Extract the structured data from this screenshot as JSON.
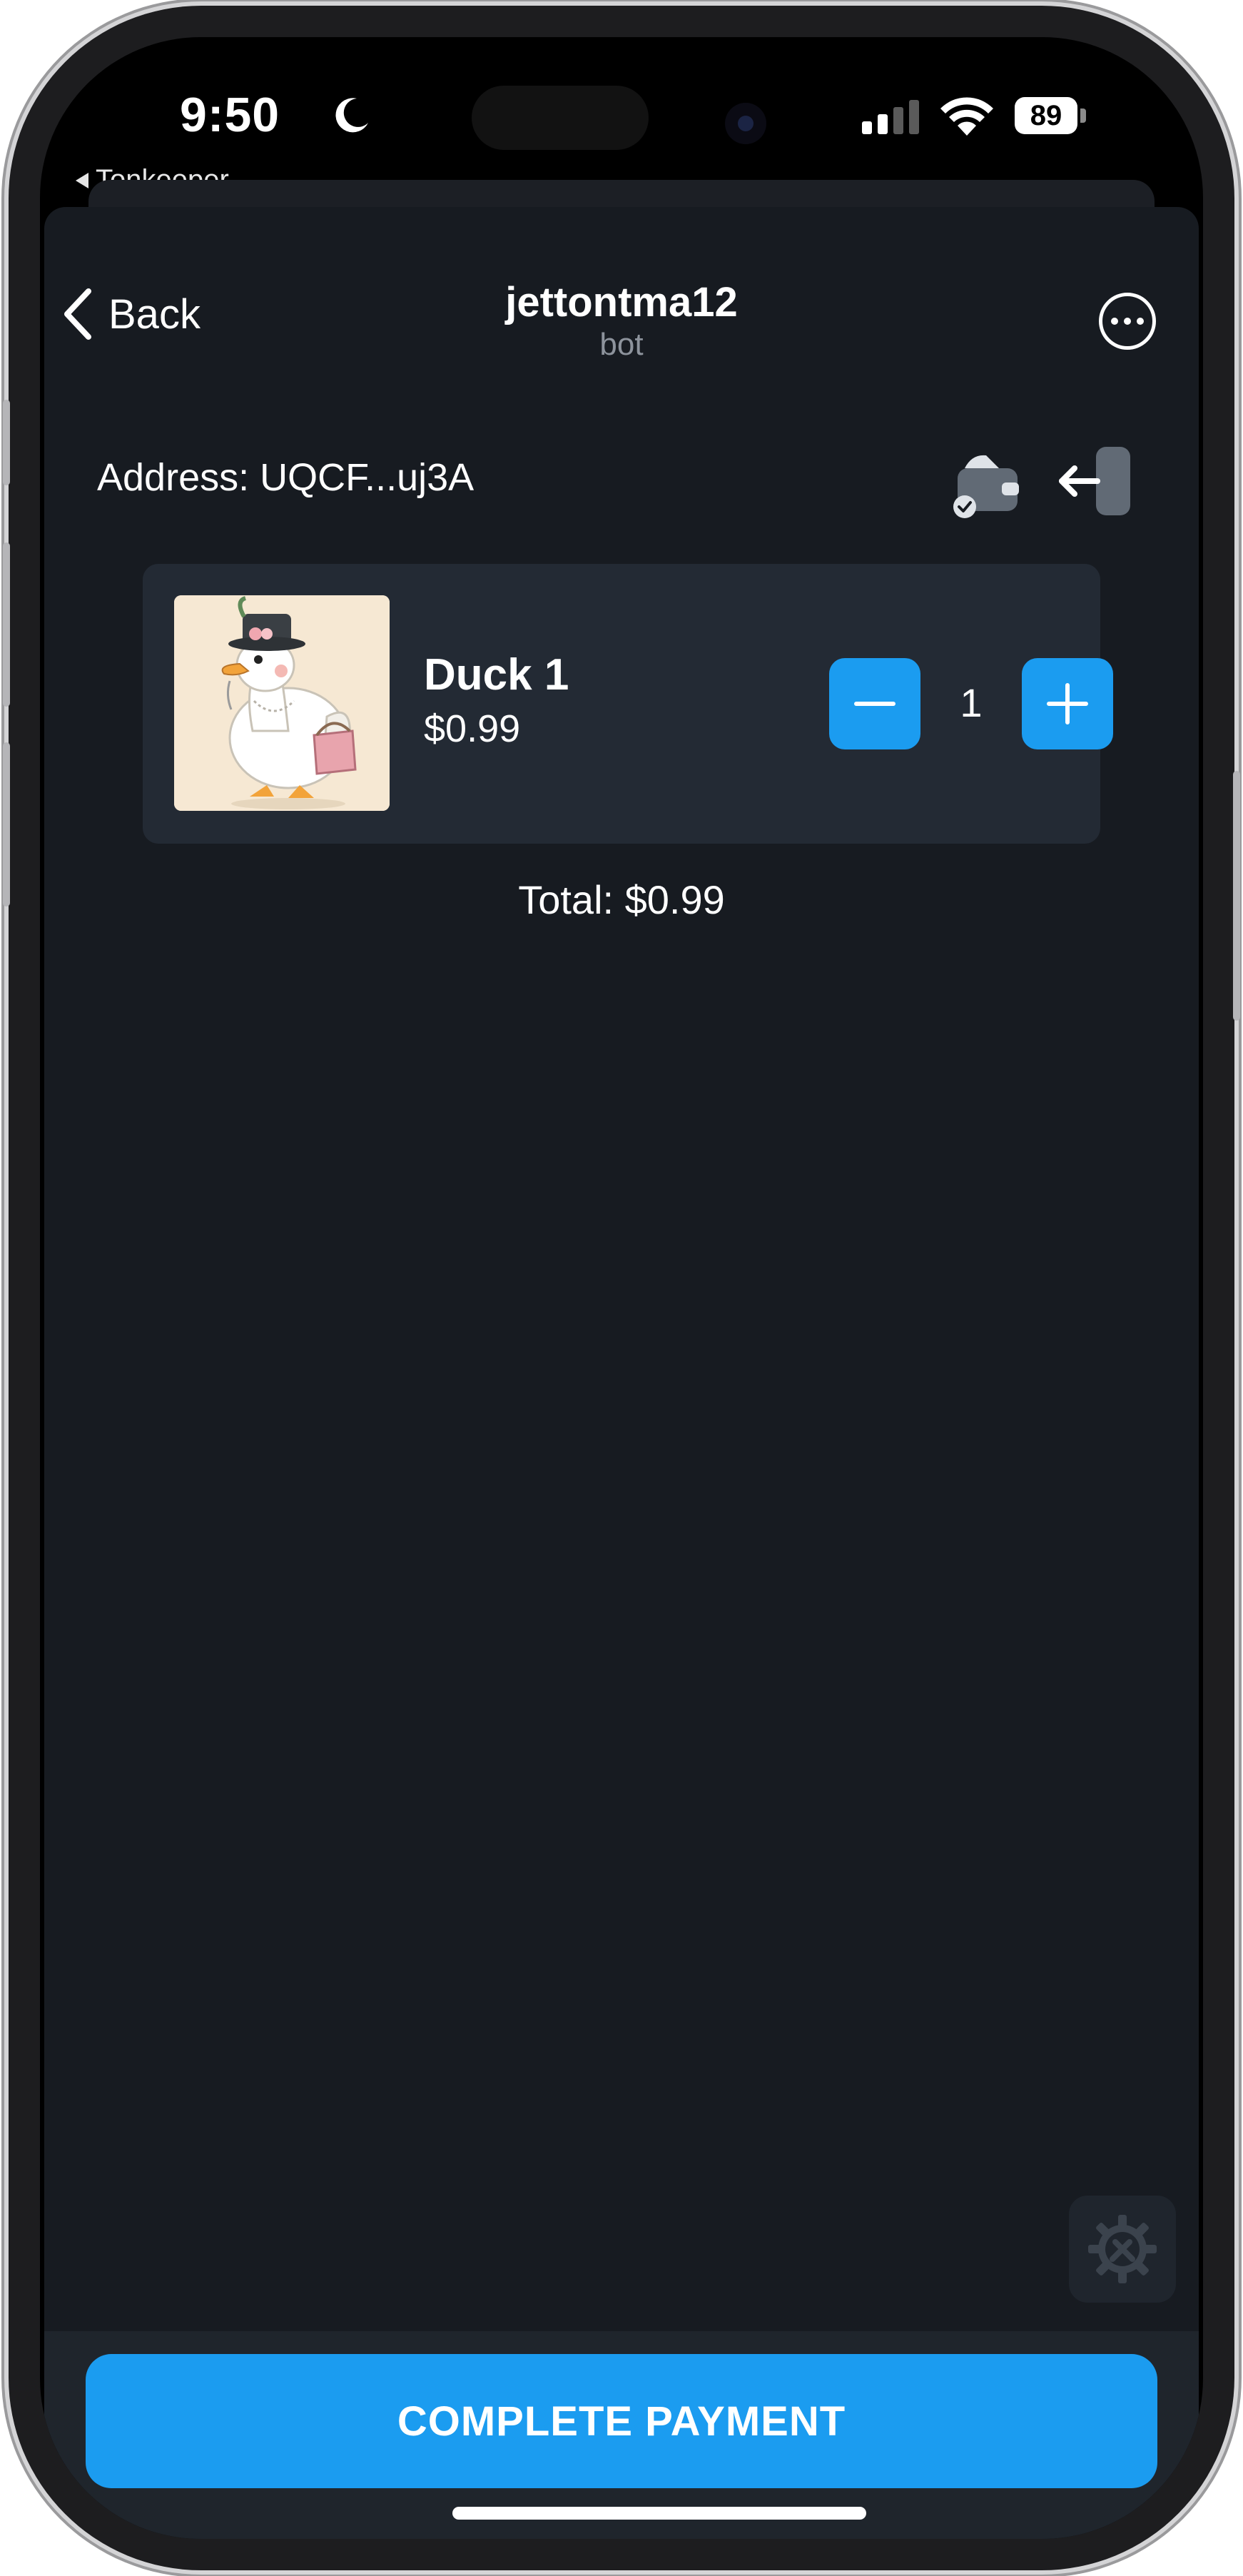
{
  "status_bar": {
    "time": "9:50",
    "back_app": "Tonkeeper",
    "battery": "89"
  },
  "nav": {
    "back_label": "Back",
    "title": "jettontma12",
    "subtitle": "bot"
  },
  "wallet": {
    "address": "Address: UQCF...uj3A"
  },
  "cart": {
    "items": [
      {
        "name": "Duck 1",
        "price": "$0.99",
        "quantity": "1"
      }
    ],
    "total": "Total: $0.99"
  },
  "actions": {
    "pay_label": "COMPLETE PAYMENT"
  },
  "colors": {
    "accent": "#1b9cf0",
    "background": "#171b21",
    "card": "#232a34"
  }
}
